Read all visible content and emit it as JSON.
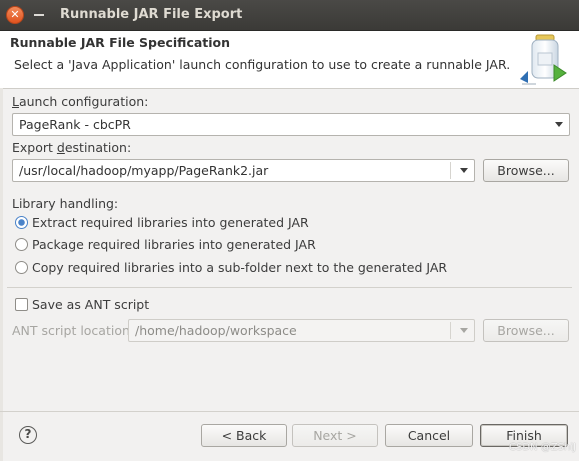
{
  "window": {
    "title": "Runnable JAR File Export"
  },
  "header": {
    "title": "Runnable JAR File Specification",
    "description": "Select a 'Java Application' launch configuration to use to create a runnable JAR."
  },
  "launch": {
    "label": "Launch configuration:",
    "value": "PageRank - cbcPR"
  },
  "export": {
    "label": "Export destination:",
    "value": "/usr/local/hadoop/myapp/PageRank2.jar",
    "browse": "Browse..."
  },
  "library": {
    "label": "Library handling:",
    "options": [
      {
        "label": "Extract required libraries into generated JAR",
        "checked": true
      },
      {
        "label": "Package required libraries into generated JAR",
        "checked": false
      },
      {
        "label": "Copy required libraries into a sub-folder next to the generated JAR",
        "checked": false
      }
    ]
  },
  "ant": {
    "save_label": "Save as ANT script",
    "location_label": "ANT script location:",
    "location_value": "/home/hadoop/workspace",
    "browse": "Browse..."
  },
  "footer": {
    "help": "?",
    "back": "< Back",
    "next": "Next >",
    "cancel": "Cancel",
    "finish": "Finish"
  },
  "watermark": "CSDN @ZShiJ"
}
